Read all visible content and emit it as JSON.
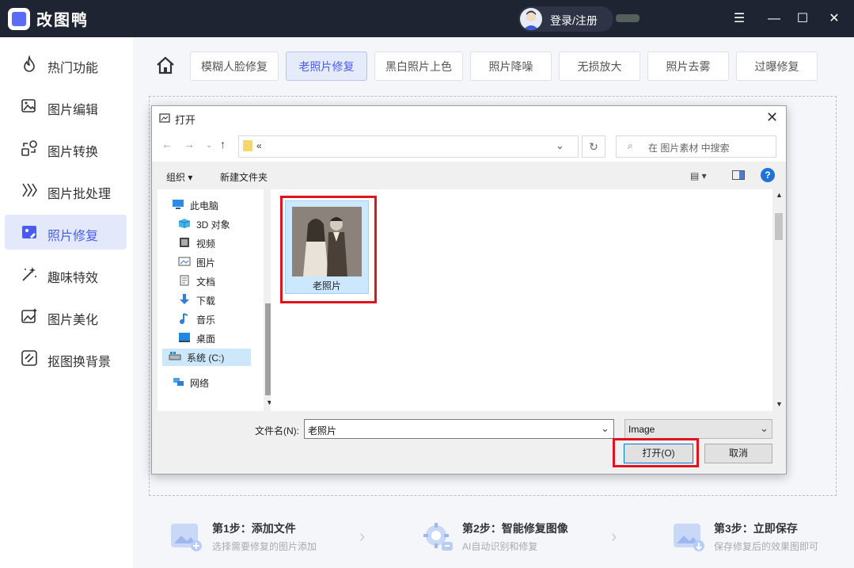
{
  "app": {
    "title": "改图鸭",
    "login_label": "登录/注册"
  },
  "window_controls": [
    "menu-icon",
    "minimize-icon",
    "maximize-icon",
    "close-icon"
  ],
  "sidebar": {
    "items": [
      {
        "label": "热门功能",
        "icon": "fire-icon"
      },
      {
        "label": "图片编辑",
        "icon": "image-edit-icon"
      },
      {
        "label": "图片转换",
        "icon": "convert-icon"
      },
      {
        "label": "图片批处理",
        "icon": "batch-icon"
      },
      {
        "label": "照片修复",
        "icon": "photo-repair-icon",
        "active": true
      },
      {
        "label": "趣味特效",
        "icon": "magic-wand-icon"
      },
      {
        "label": "图片美化",
        "icon": "beautify-icon"
      },
      {
        "label": "抠图换背景",
        "icon": "cutout-icon"
      }
    ]
  },
  "tabs": [
    {
      "label": "模糊人脸修复"
    },
    {
      "label": "老照片修复",
      "active": true
    },
    {
      "label": "黑白照片上色"
    },
    {
      "label": "照片降噪"
    },
    {
      "label": "无损放大"
    },
    {
      "label": "照片去雾"
    },
    {
      "label": "过曝修复"
    }
  ],
  "steps": [
    {
      "title": "第1步：添加文件",
      "desc": "选择需要修复的图片添加"
    },
    {
      "title": "第2步：智能修复图像",
      "desc": "AI自动识别和修复"
    },
    {
      "title": "第3步：立即保存",
      "desc": "保存修复后的效果图即可"
    }
  ],
  "dialog": {
    "title": "打开",
    "address": "«",
    "search_placeholder": "在 图片素材 中搜索",
    "toolbar": {
      "organize": "组织 ▾",
      "new_folder": "新建文件夹"
    },
    "tree": [
      {
        "label": "此电脑",
        "icon": "computer-icon",
        "indent": 0
      },
      {
        "label": "3D 对象",
        "icon": "3d-objects-icon",
        "indent": 1
      },
      {
        "label": "视频",
        "icon": "video-folder-icon",
        "indent": 1
      },
      {
        "label": "图片",
        "icon": "pictures-folder-icon",
        "indent": 1
      },
      {
        "label": "文档",
        "icon": "documents-folder-icon",
        "indent": 1
      },
      {
        "label": "下载",
        "icon": "download-folder-icon",
        "indent": 1
      },
      {
        "label": "音乐",
        "icon": "music-folder-icon",
        "indent": 1
      },
      {
        "label": "桌面",
        "icon": "desktop-folder-icon",
        "indent": 1
      },
      {
        "label": "系统 (C:)",
        "icon": "drive-icon",
        "indent": 1,
        "selected": true
      },
      {
        "label": "网络",
        "icon": "network-icon",
        "indent": 0
      }
    ],
    "file": {
      "name": "老照片"
    },
    "filename_label": "文件名(N):",
    "filename_value": "老照片",
    "filetype_value": "Image",
    "open_label": "打开(O)",
    "cancel_label": "取消"
  },
  "colors": {
    "accent": "#4a5cf0",
    "titlebar": "#1f2433",
    "highlight_red": "#e0141e"
  }
}
